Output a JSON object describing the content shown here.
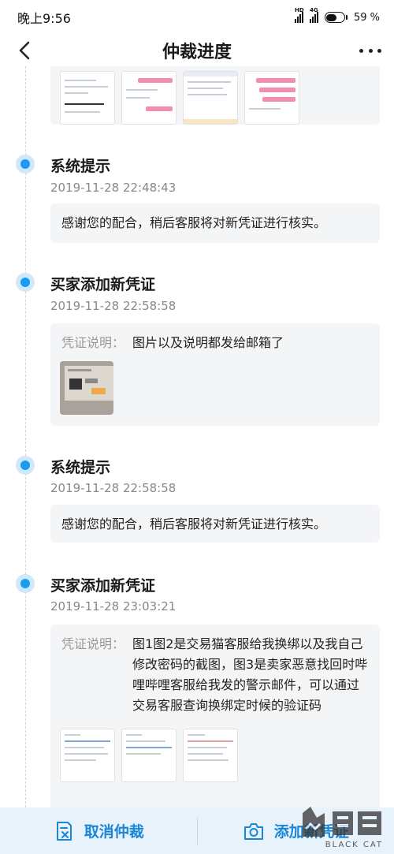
{
  "status_bar": {
    "time": "晚上9:56",
    "signal1_label": "HD",
    "signal2_label": "4G",
    "battery_percent": "59 %",
    "battery_level": 0.59
  },
  "nav": {
    "title": "仲裁进度"
  },
  "events": [
    {
      "title": "系统提示",
      "time": "2019-11-28 22:48:43",
      "message": "感谢您的配合，稍后客服将对新凭证进行核实。"
    },
    {
      "title": "买家添加新凭证",
      "time": "2019-11-28 22:58:58",
      "desc_label": "凭证说明：",
      "desc": "图片以及说明都发给邮箱了"
    },
    {
      "title": "系统提示",
      "time": "2019-11-28 22:58:58",
      "message": "感谢您的配合，稍后客服将对新凭证进行核实。"
    },
    {
      "title": "买家添加新凭证",
      "time": "2019-11-28 23:03:21",
      "desc_label": "凭证说明：",
      "desc": "图1图2是交易猫客服给我换绑以及我自己修改密码的截图，图3是卖家恶意找回时哔哩哔哩客服给我发的警示邮件，可以通过交易客服查询换绑定时候的验证码"
    }
  ],
  "bottom_bar": {
    "cancel_label": "取消仲裁",
    "add_label": "添加新凭证"
  },
  "watermark": {
    "text": "BLACK CAT"
  },
  "colors": {
    "accent": "#1a9cf0",
    "bottom_text": "#1b86d6",
    "bottom_bg": "#e8f2fb",
    "card_bg": "#f4f5f7"
  }
}
